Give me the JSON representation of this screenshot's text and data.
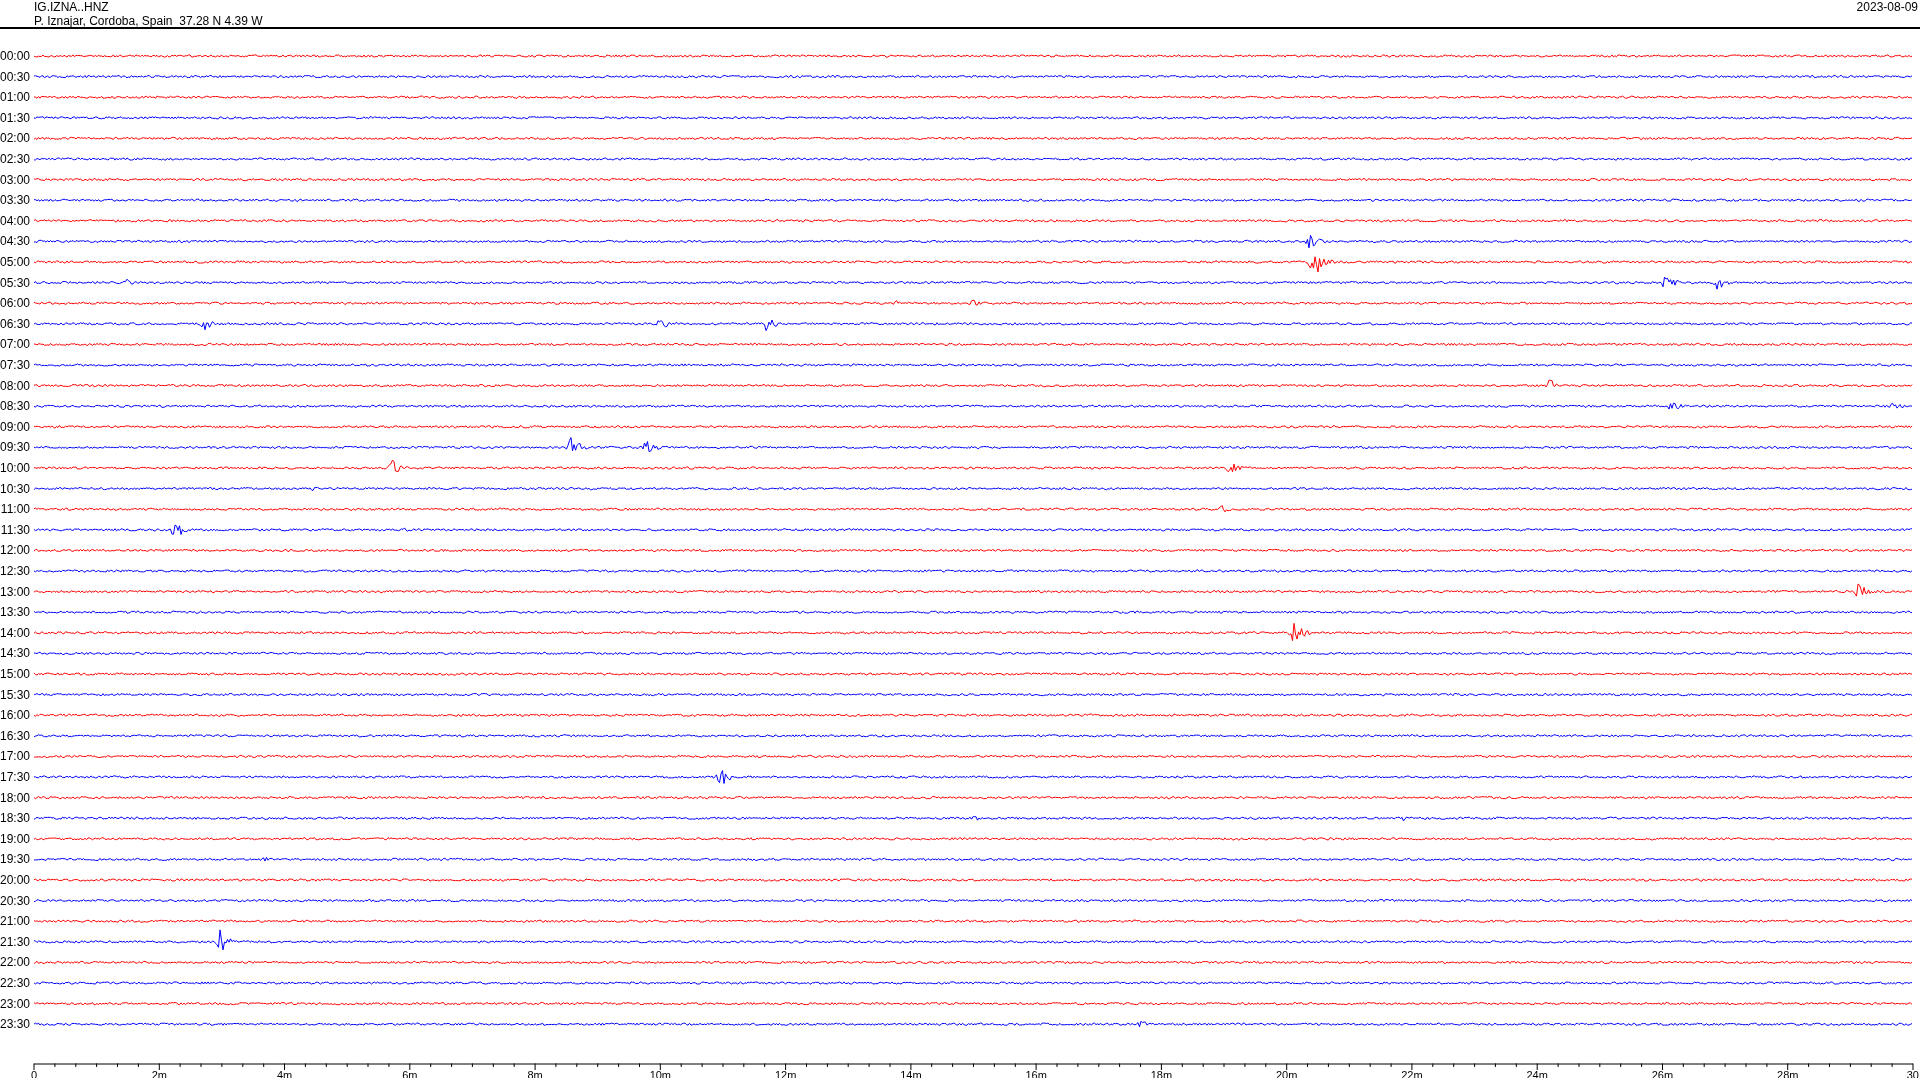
{
  "header": {
    "station": "IG.IZNA..HNZ",
    "location": "P. Iznajar, Cordoba, Spain  37.28 N 4.39 W",
    "date": "2023-08-09"
  },
  "rows": [
    {
      "label": "00:00",
      "color": "#ff0000"
    },
    {
      "label": "00:30",
      "color": "#0000ff"
    },
    {
      "label": "01:00",
      "color": "#ff0000"
    },
    {
      "label": "01:30",
      "color": "#0000ff"
    },
    {
      "label": "02:00",
      "color": "#ff0000"
    },
    {
      "label": "02:30",
      "color": "#0000ff"
    },
    {
      "label": "03:00",
      "color": "#ff0000"
    },
    {
      "label": "03:30",
      "color": "#0000ff"
    },
    {
      "label": "04:00",
      "color": "#ff0000"
    },
    {
      "label": "04:30",
      "color": "#0000ff"
    },
    {
      "label": "05:00",
      "color": "#ff0000"
    },
    {
      "label": "05:30",
      "color": "#0000ff"
    },
    {
      "label": "06:00",
      "color": "#ff0000"
    },
    {
      "label": "06:30",
      "color": "#0000ff"
    },
    {
      "label": "07:00",
      "color": "#ff0000"
    },
    {
      "label": "07:30",
      "color": "#0000ff"
    },
    {
      "label": "08:00",
      "color": "#ff0000"
    },
    {
      "label": "08:30",
      "color": "#0000ff"
    },
    {
      "label": "09:00",
      "color": "#ff0000"
    },
    {
      "label": "09:30",
      "color": "#0000ff"
    },
    {
      "label": "10:00",
      "color": "#ff0000"
    },
    {
      "label": "10:30",
      "color": "#0000ff"
    },
    {
      "label": "11:00",
      "color": "#ff0000"
    },
    {
      "label": "11:30",
      "color": "#0000ff"
    },
    {
      "label": "12:00",
      "color": "#ff0000"
    },
    {
      "label": "12:30",
      "color": "#0000ff"
    },
    {
      "label": "13:00",
      "color": "#ff0000"
    },
    {
      "label": "13:30",
      "color": "#0000ff"
    },
    {
      "label": "14:00",
      "color": "#ff0000"
    },
    {
      "label": "14:30",
      "color": "#0000ff"
    },
    {
      "label": "15:00",
      "color": "#ff0000"
    },
    {
      "label": "15:30",
      "color": "#0000ff"
    },
    {
      "label": "16:00",
      "color": "#ff0000"
    },
    {
      "label": "16:30",
      "color": "#0000ff"
    },
    {
      "label": "17:00",
      "color": "#ff0000"
    },
    {
      "label": "17:30",
      "color": "#0000ff"
    },
    {
      "label": "18:00",
      "color": "#ff0000"
    },
    {
      "label": "18:30",
      "color": "#0000ff"
    },
    {
      "label": "19:00",
      "color": "#ff0000"
    },
    {
      "label": "19:30",
      "color": "#0000ff"
    },
    {
      "label": "20:00",
      "color": "#ff0000"
    },
    {
      "label": "20:30",
      "color": "#0000ff"
    },
    {
      "label": "21:00",
      "color": "#ff0000"
    },
    {
      "label": "21:30",
      "color": "#0000ff"
    },
    {
      "label": "22:00",
      "color": "#ff0000"
    },
    {
      "label": "22:30",
      "color": "#0000ff"
    },
    {
      "label": "23:00",
      "color": "#ff0000"
    },
    {
      "label": "23:30",
      "color": "#0000ff"
    }
  ],
  "x_axis": {
    "ticks": [
      "0",
      "2m",
      "4m",
      "6m",
      "8m",
      "10m",
      "12m",
      "14m",
      "16m",
      "18m",
      "20m",
      "22m",
      "24m",
      "26m",
      "28m",
      "30"
    ]
  }
}
